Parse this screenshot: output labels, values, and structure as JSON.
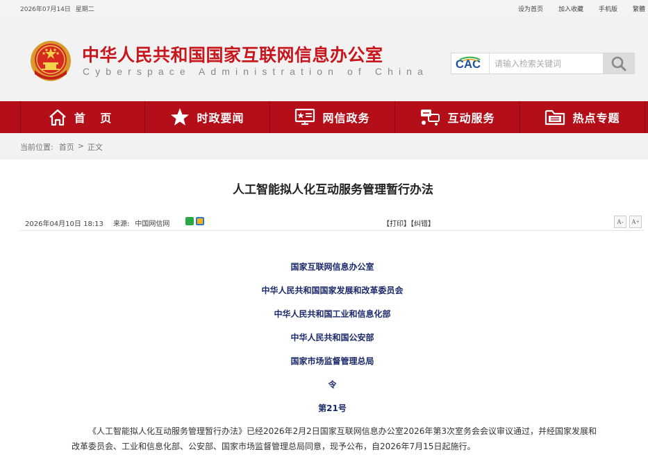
{
  "topbar": {
    "date": "2026年07月14日",
    "weekday": "星期二",
    "links": [
      "设为首页",
      "加入收藏",
      "手机版",
      "繁體"
    ]
  },
  "header": {
    "title": "中华人民共和国国家互联网信息办公室",
    "subtitle": "Cyberspace Administration of China",
    "logo_text": "CAC",
    "search_placeholder": "请输入检索关键词"
  },
  "nav": {
    "items": [
      {
        "label": "首 页",
        "icon": "home-icon"
      },
      {
        "label": "时政要闻",
        "icon": "star-icon"
      },
      {
        "label": "网信政务",
        "icon": "monitor-icon"
      },
      {
        "label": "互动服务",
        "icon": "interact-icon"
      },
      {
        "label": "热点专题",
        "icon": "folder-icon"
      }
    ]
  },
  "breadcrumb": {
    "prefix": "当前位置:",
    "items": [
      "首页",
      "正文"
    ],
    "separator": ">"
  },
  "article": {
    "title": "人工智能拟人化互动服务管理暂行办法",
    "date": "2026年04月10日  18:13",
    "source_label": "来源:",
    "source": "中国网信网",
    "print": "【打印】",
    "correct": "【纠错】",
    "font_smaller": "A-",
    "font_larger": "A+",
    "issuers": [
      "国家互联网信息办公室",
      "中华人民共和国国家发展和改革委员会",
      "中华人民共和国工业和信息化部",
      "中华人民共和国公安部",
      "国家市场监督管理总局",
      "令",
      "第21号"
    ],
    "paragraph": "《人工智能拟人化互动服务管理暂行办法》已经2026年2月2日国家互联网信息办公室2026年第3次室务会会议审议通过，并经国家发展和改革委员会、工业和信息化部、公安部、国家市场监督管理总局同意，现予公布，自2026年7月15日起施行。"
  },
  "colors": {
    "brand_red": "#b40f19",
    "title_red": "#c8161d",
    "issuer_blue": "#1b2a6b"
  }
}
